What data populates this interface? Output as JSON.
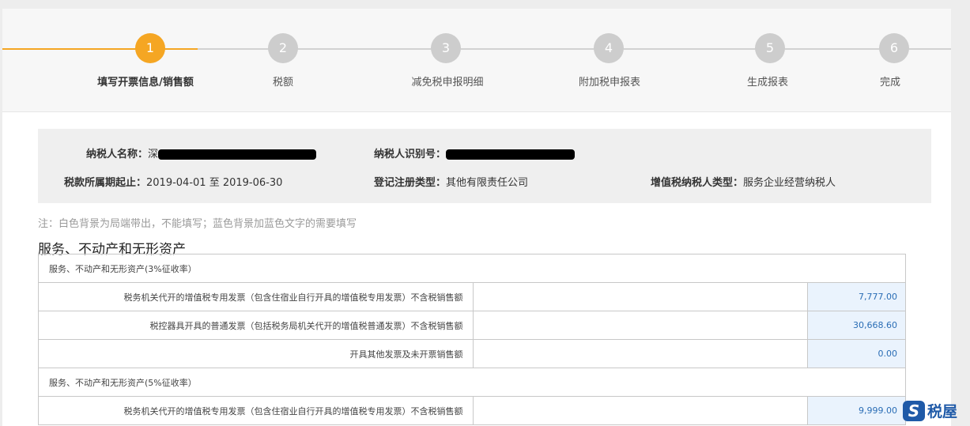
{
  "steps": [
    {
      "num": "1",
      "label": "填写开票信息/销售额",
      "active": true
    },
    {
      "num": "2",
      "label": "税额",
      "active": false
    },
    {
      "num": "3",
      "label": "减免税申报明细",
      "active": false
    },
    {
      "num": "4",
      "label": "附加税申报表",
      "active": false
    },
    {
      "num": "5",
      "label": "生成报表",
      "active": false
    },
    {
      "num": "6",
      "label": "完成",
      "active": false
    }
  ],
  "info": {
    "taxpayer_name_label": "纳税人名称：",
    "taxpayer_name_value": "深",
    "taxpayer_id_label": "纳税人识别号：",
    "period_label": "税款所属期起止：",
    "period_value": "2019-04-01 至 2019-06-30",
    "reg_type_label": "登记注册类型：",
    "reg_type_value": "其他有限责任公司",
    "vat_type_label": "增值税纳税人类型：",
    "vat_type_value": "服务企业经营纳税人"
  },
  "note": "注：白色背景为局端带出，不能填写；蓝色背景加蓝色文字的需要填写",
  "section_title": "服务、不动产和无形资产",
  "table": {
    "group1_title": "服务、不动产和无形资产(3%征收率）",
    "group1_rows": [
      {
        "label": "税务机关代开的增值税专用发票（包含住宿业自行开具的增值税专用发票）不含税销售额",
        "value": "7,777.00"
      },
      {
        "label": "税控器具开具的普通发票（包括税务局机关代开的增值税普通发票）不含税销售额",
        "value": "30,668.60"
      },
      {
        "label": "开具其他发票及未开票销售额",
        "value": "0.00"
      }
    ],
    "group2_title": "服务、不动产和无形资产(5%征收率）",
    "group2_rows": [
      {
        "label": "税务机关代开的增值税专用发票（包含住宿业自行开具的增值税专用发票）不含税销售额",
        "value": "9,999.00"
      }
    ]
  },
  "logo": {
    "mark": "S",
    "text": "税屋"
  },
  "colors": {
    "accent": "#f5a623",
    "inactive": "#cdcdcd",
    "input_bg": "#eaf3fd",
    "input_text": "#2a6db5"
  }
}
